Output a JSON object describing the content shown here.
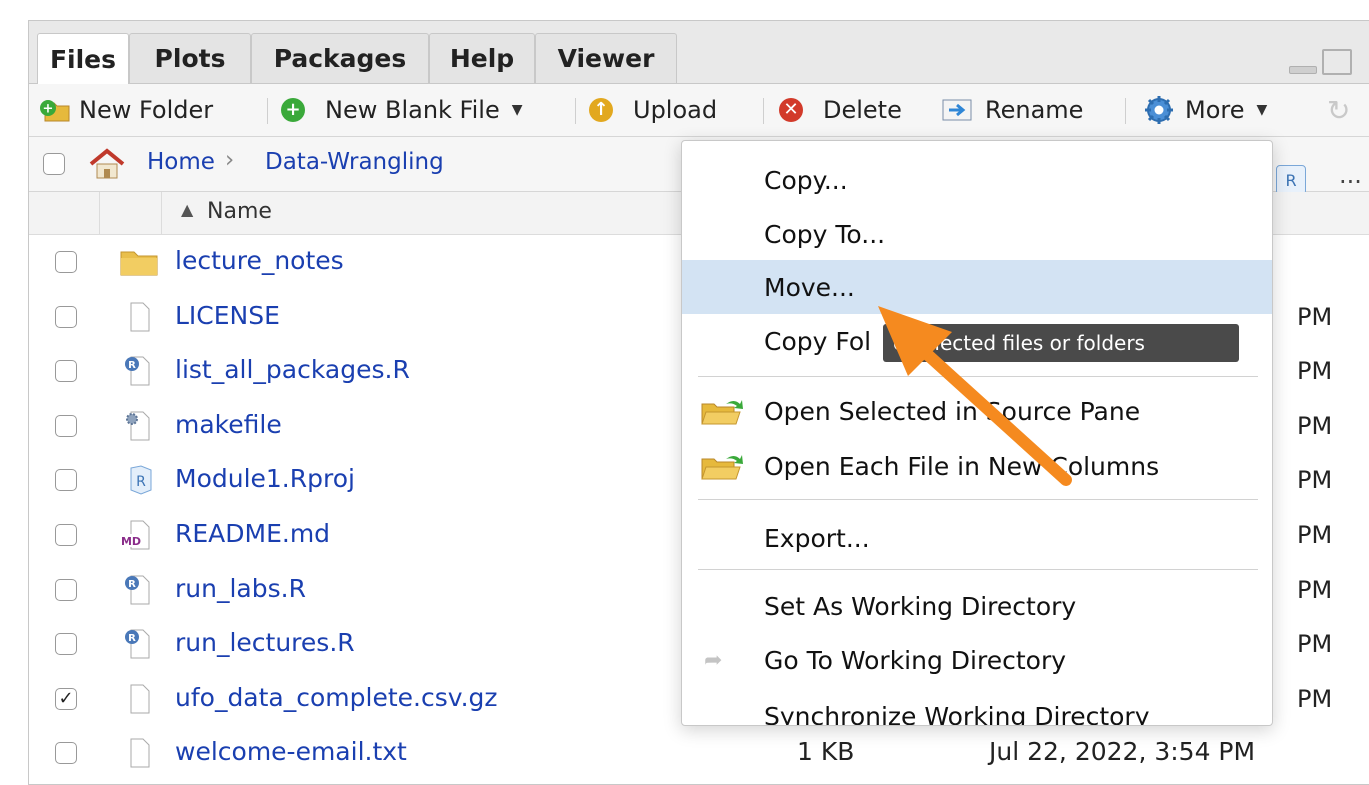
{
  "tabs": [
    "Files",
    "Plots",
    "Packages",
    "Help",
    "Viewer"
  ],
  "toolbar": {
    "new_folder": "New Folder",
    "new_blank_file": "New Blank File",
    "upload": "Upload",
    "delete": "Delete",
    "rename": "Rename",
    "more": "More"
  },
  "path": {
    "home": "Home",
    "folder": "Data-Wrangling",
    "more": "..."
  },
  "columns": {
    "name": "Name",
    "sort_arrow": "▲"
  },
  "files": [
    {
      "name": "lecture_notes",
      "icon": "folder-icon",
      "checked": false,
      "size": "",
      "modified": "",
      "pm": ""
    },
    {
      "name": "LICENSE",
      "icon": "document-icon",
      "checked": false,
      "size": "",
      "modified": "",
      "pm": "PM"
    },
    {
      "name": "list_all_packages.R",
      "icon": "r-file-icon",
      "checked": false,
      "size": "",
      "modified": "",
      "pm": "PM"
    },
    {
      "name": "makefile",
      "icon": "gear-file-icon",
      "checked": false,
      "size": "",
      "modified": "",
      "pm": "PM"
    },
    {
      "name": "Module1.Rproj",
      "icon": "rproj-icon",
      "checked": false,
      "size": "",
      "modified": "",
      "pm": "PM"
    },
    {
      "name": "README.md",
      "icon": "markdown-icon",
      "checked": false,
      "size": "",
      "modified": "",
      "pm": "PM"
    },
    {
      "name": "run_labs.R",
      "icon": "r-file-icon",
      "checked": false,
      "size": "",
      "modified": "",
      "pm": "PM"
    },
    {
      "name": "run_lectures.R",
      "icon": "r-file-icon",
      "checked": false,
      "size": "",
      "modified": "",
      "pm": "PM"
    },
    {
      "name": "ufo_data_complete.csv.gz",
      "icon": "document-icon",
      "checked": true,
      "size": "",
      "modified": "",
      "pm": "PM"
    },
    {
      "name": "welcome-email.txt",
      "icon": "document-icon",
      "checked": false,
      "size": "1 KB",
      "modified": "Jul 22, 2022, 3:54 PM",
      "pm": ""
    }
  ],
  "menu": {
    "copy": "Copy...",
    "copy_to": "Copy To...",
    "move": "Move...",
    "copy_folder": "Copy Fol",
    "open_selected": "Open Selected in Source Pane",
    "open_each": "Open Each File in New Columns",
    "export": "Export...",
    "set_wd": "Set As Working Directory",
    "go_to_wd": "Go To Working Directory",
    "sync_wd": "Synchronize Working Directory"
  },
  "tooltip": "e selected files or folders",
  "colors": {
    "link": "#1a3fb0",
    "highlight": "#d3e3f3",
    "arrow": "#f58a1f"
  }
}
